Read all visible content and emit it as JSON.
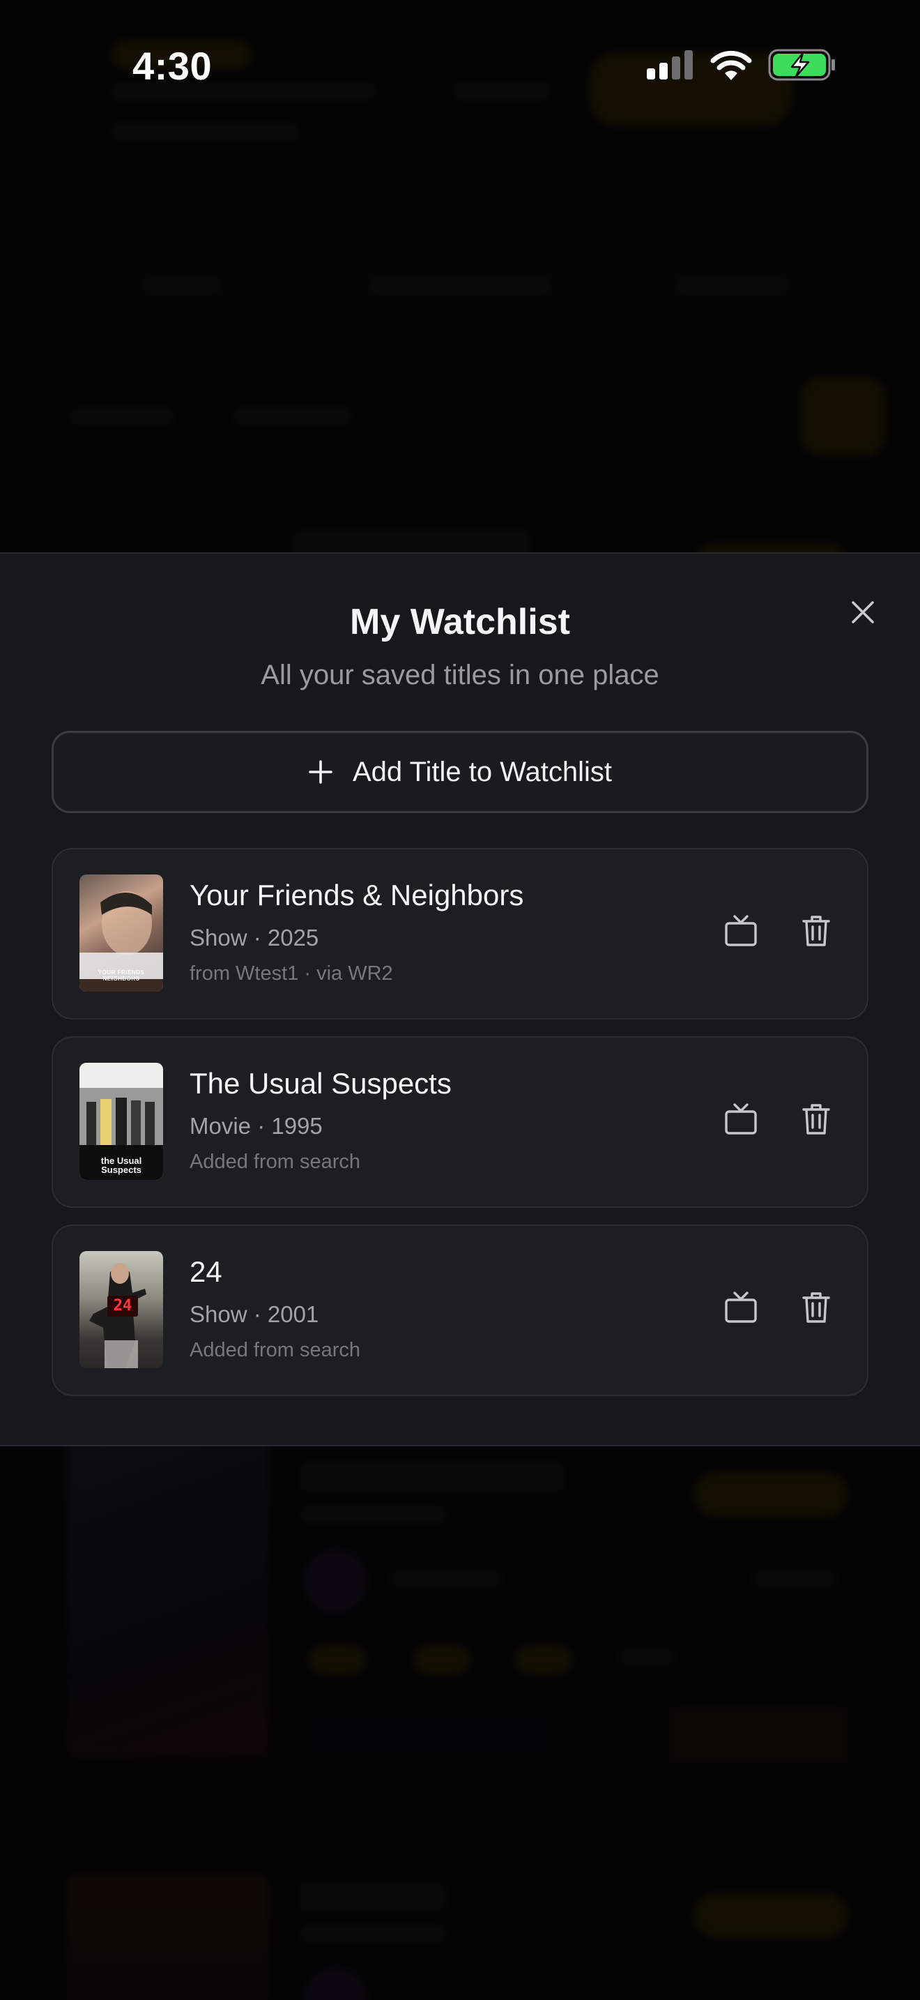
{
  "status_bar": {
    "time": "4:30",
    "icons": [
      "cellular-signal-icon",
      "wifi-icon",
      "battery-charging-icon"
    ]
  },
  "watchlist": {
    "title": "My Watchlist",
    "subtitle": "All your saved titles in one place",
    "add_button_label": "Add Title to Watchlist",
    "items": [
      {
        "title": "Your Friends & Neighbors",
        "meta": "Show · 2025",
        "source": "from Wtest1 · via WR2",
        "poster_text": "YOUR FRIENDS NEIGHBORS"
      },
      {
        "title": "The Usual Suspects",
        "meta": "Movie · 1995",
        "source": "Added from search",
        "poster_text": "the Usual Suspects"
      },
      {
        "title": "24",
        "meta": "Show · 2001",
        "source": "Added from search",
        "poster_text": "24"
      }
    ]
  },
  "colors": {
    "sheet_bg": "#17181b",
    "card_bg": "#1d1e22",
    "accent_dim": "#6e4f00",
    "battery_green": "#3ddc5c"
  }
}
